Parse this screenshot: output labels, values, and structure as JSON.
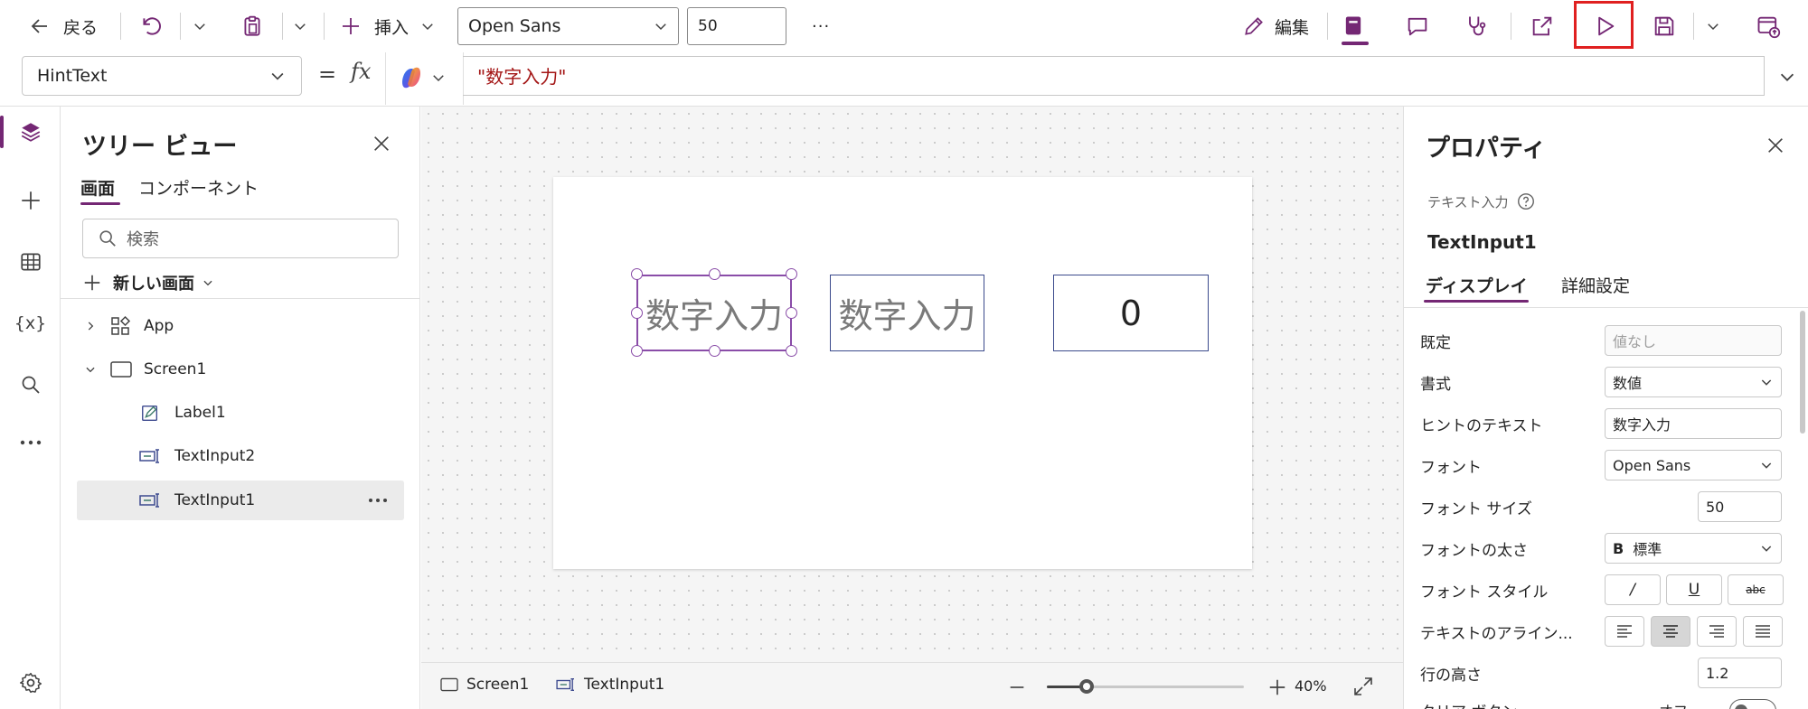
{
  "toolbar": {
    "back_label": "戻る",
    "insert_label": "挿入",
    "font_value": "Open Sans",
    "font_size_value": "50",
    "more_label": "···",
    "edit_label": "編集"
  },
  "formula": {
    "property_value": "HintText",
    "equals": "=",
    "fx": "fx",
    "expression": "\"数字入力\""
  },
  "left_rail": {
    "vars_label": "{x}"
  },
  "tree_view": {
    "title": "ツリー ビュー",
    "tabs": [
      {
        "label": "画面",
        "active": true
      },
      {
        "label": "コンポーネント",
        "active": false
      }
    ],
    "search_placeholder": "検索",
    "new_screen_label": "新しい画面",
    "items": [
      {
        "label": "App"
      },
      {
        "label": "Screen1"
      },
      {
        "label": "Label1"
      },
      {
        "label": "TextInput2"
      },
      {
        "label": "TextInput1",
        "selected": true
      }
    ]
  },
  "canvas": {
    "input1_text": "数字入力",
    "input2_text": "数字入力",
    "input3_text": "0"
  },
  "status_bar": {
    "screen_label": "Screen1",
    "control_label": "TextInput1",
    "zoom_value": "40%",
    "zoom_fraction": 0.2
  },
  "properties": {
    "title": "プロパティ",
    "control_type": "テキスト入力",
    "control_name": "TextInput1",
    "tabs": [
      {
        "label": "ディスプレイ",
        "active": true
      },
      {
        "label": "詳細設定",
        "active": false
      }
    ],
    "rows": {
      "default_label": "既定",
      "default_placeholder": "値なし",
      "format_label": "書式",
      "format_value": "数値",
      "hint_label": "ヒントのテキスト",
      "hint_value": "数字入力",
      "font_label": "フォント",
      "font_value": "Open Sans",
      "font_size_label": "フォント サイズ",
      "font_size_value": "50",
      "font_weight_label": "フォントの太さ",
      "font_weight_value": "標準",
      "font_weight_icon": "B",
      "font_style_label": "フォント スタイル",
      "italic_glyph": "/",
      "underline_glyph": "U",
      "strike_glyph": "abc",
      "align_label": "テキストのアライン...",
      "line_height_label": "行の高さ",
      "line_height_value": "1.2",
      "clear_button_label": "クリア ボタン",
      "clear_button_state": "オフ"
    }
  },
  "colors": {
    "accent": "#742774",
    "highlight_red": "#e02020",
    "formula_string": "#a31515",
    "input_border": "#3b4a8c",
    "selection": "#8a4da8"
  }
}
